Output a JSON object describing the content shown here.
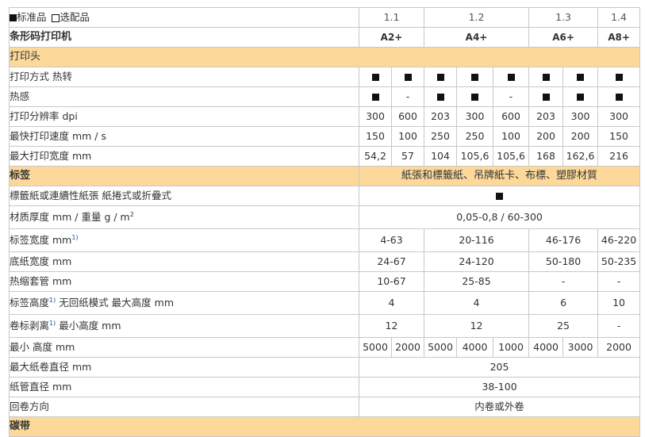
{
  "legend": {
    "standard": "标准品",
    "optional": "选配品"
  },
  "versions": [
    "1.1",
    "1.2",
    "1.3",
    "1.4"
  ],
  "header": {
    "label": "条形码打印机",
    "models": [
      "A2+",
      "A4+",
      "A6+",
      "A8+"
    ]
  },
  "sections": {
    "print_head": "打印头",
    "label": "标签",
    "label_materials": "紙張和標籤紙、吊牌紙卡、布標、塑膠材質",
    "ribbon": "碳带"
  },
  "rows": {
    "print_method": "打印方式 热转",
    "thermal": "热感",
    "dash": "-",
    "resolution": {
      "label": "打印分辨率 dpi",
      "values": [
        "300",
        "600",
        "203",
        "300",
        "600",
        "203",
        "300",
        "300"
      ]
    },
    "speed": {
      "label": "最快打印速度 mm / s",
      "values": [
        "150",
        "100",
        "250",
        "250",
        "100",
        "200",
        "200",
        "150"
      ]
    },
    "width": {
      "label": "最大打印宽度 mm",
      "values": [
        "54,2",
        "57",
        "104",
        "105,6",
        "105,6",
        "168",
        "162,6",
        "216"
      ]
    },
    "media": {
      "label": "標籤紙或連續性紙張 紙捲式或折疊式"
    },
    "thickness": {
      "label_a": "材质厚度 mm / 重量 g / m",
      "label_sup": "2",
      "value": "0,05-0,8 / 60-300"
    },
    "label_width": {
      "label": "标签宽度 mm",
      "sup": "1)",
      "values": [
        "4-63",
        "20-116",
        "46-176",
        "46-220"
      ]
    },
    "backing_width": {
      "label": "底纸宽度 mm",
      "values": [
        "24-67",
        "24-120",
        "50-180",
        "50-235"
      ]
    },
    "shrink_tube": {
      "label": "热缩套管 mm",
      "values": [
        "10-67",
        "25-85",
        "-",
        "-"
      ]
    },
    "label_height": {
      "label_a": "标签高度",
      "sup": "1)",
      "label_b": " 无回纸模式 最大高度 mm",
      "values": [
        "4",
        "4",
        "6",
        "10"
      ]
    },
    "peel": {
      "label_a": "卷标剥离",
      "sup": "1)",
      "label_b": " 最小高度 mm",
      "values": [
        "12",
        "12",
        "25",
        "-"
      ]
    },
    "min_height": {
      "label": "最小 高度 mm",
      "values": [
        "5000",
        "2000",
        "5000",
        "4000",
        "1000",
        "4000",
        "3000",
        "2000"
      ]
    },
    "roll_diameter": {
      "label": "最大纸卷直径 mm",
      "value": "205"
    },
    "core_diameter": {
      "label": "纸管直径 mm",
      "value": "38-100"
    },
    "winding": {
      "label": "回卷方向",
      "value": "内卷或外卷"
    }
  },
  "colors": {
    "section_bg": "#fcd99a",
    "border": "#c8c8c8",
    "sup_blue": "#1a5aa8"
  }
}
